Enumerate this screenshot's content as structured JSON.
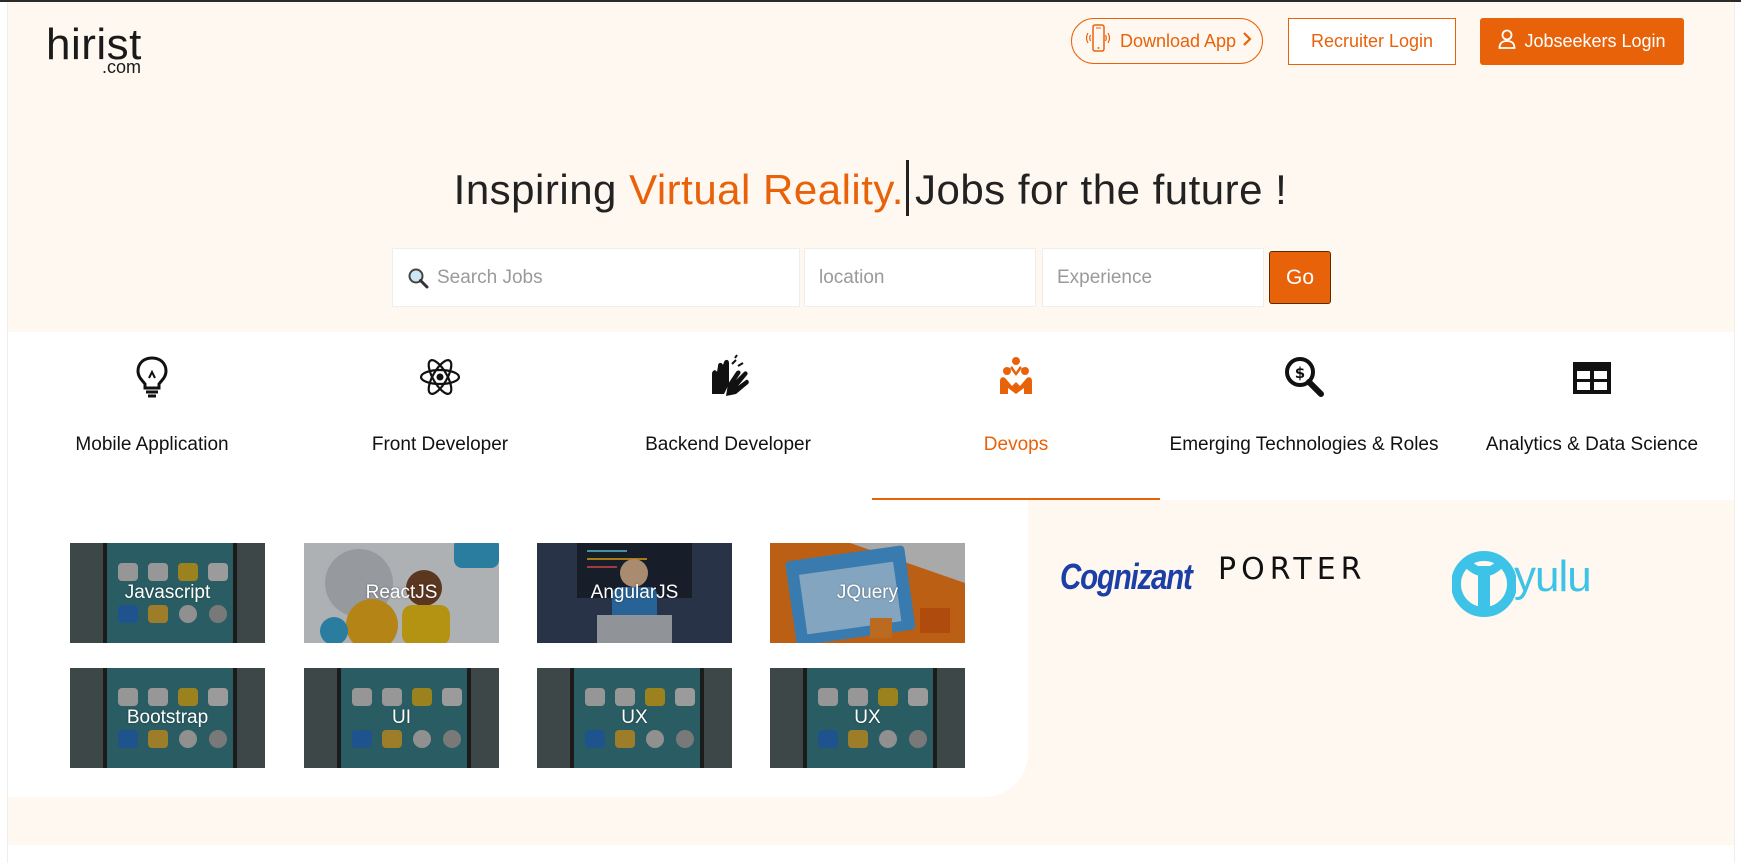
{
  "header": {
    "logo_main": "hirist",
    "logo_sub": ".com",
    "download_app": "Download App",
    "recruiter_login": "Recruiter Login",
    "jobseekers_login": "Jobseekers Login"
  },
  "hero": {
    "headline_prefix": "Inspiring ",
    "headline_accent": "Virtual Reality.",
    "headline_suffix": "Jobs for the future !",
    "search_placeholder": "Search Jobs",
    "location_placeholder": "location",
    "experience_placeholder": "Experience",
    "go_label": "Go"
  },
  "categories": [
    {
      "label": "Mobile Application",
      "icon": "lightbulb-icon"
    },
    {
      "label": "Front Developer",
      "icon": "atom-icon"
    },
    {
      "label": "Backend Developer",
      "icon": "hands-icon"
    },
    {
      "label": "Devops",
      "icon": "team-icon",
      "active": true
    },
    {
      "label": "Emerging Technologies & Roles",
      "icon": "search-dollar-icon"
    },
    {
      "label": "Analytics & Data Science",
      "icon": "table-icon"
    }
  ],
  "tiles": [
    {
      "label": "Javascript"
    },
    {
      "label": "ReactJS"
    },
    {
      "label": "AngularJS"
    },
    {
      "label": "JQuery"
    },
    {
      "label": "Bootstrap"
    },
    {
      "label": "UI"
    },
    {
      "label": "UX"
    },
    {
      "label": "UX"
    }
  ],
  "companies": [
    "Cognizant",
    "PORTER",
    "yulu"
  ],
  "colors": {
    "accent": "#e8620a",
    "hero_bg": "#fff8f0",
    "cognizant": "#1b3fa7",
    "yulu": "#3ec3e8"
  }
}
